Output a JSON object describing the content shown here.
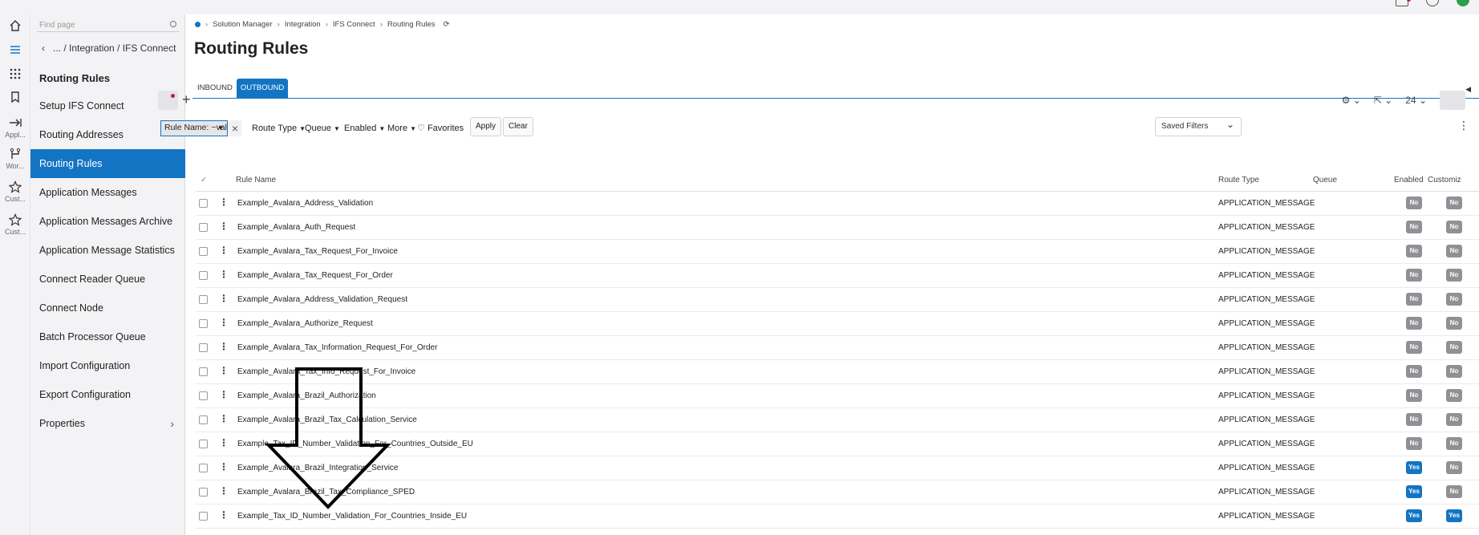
{
  "sidebar": {
    "find_placeholder": "Find page",
    "back_path": "... / Integration / IFS Connect",
    "title": "Routing Rules",
    "items": [
      {
        "label": "Setup IFS Connect",
        "has_children": true
      },
      {
        "label": "Routing Addresses"
      },
      {
        "label": "Routing Rules",
        "active": true
      },
      {
        "label": "Application Messages"
      },
      {
        "label": "Application Messages Archive"
      },
      {
        "label": "Application Message Statistics"
      },
      {
        "label": "Connect Reader Queue"
      },
      {
        "label": "Connect Node"
      },
      {
        "label": "Batch Processor Queue"
      },
      {
        "label": "Import Configuration"
      },
      {
        "label": "Export Configuration"
      },
      {
        "label": "Properties",
        "has_children": true
      }
    ]
  },
  "rail": {
    "items": [
      {
        "icon": "home-icon"
      },
      {
        "icon": "menu-icon"
      },
      {
        "icon": "apps-grid-icon"
      },
      {
        "icon": "bookmark-icon"
      },
      {
        "icon": "arrow-right-bar-icon",
        "caption": "Appl..."
      },
      {
        "icon": "workflow-icon",
        "caption": "Wor..."
      },
      {
        "icon": "star-icon",
        "caption": "Cust..."
      },
      {
        "icon": "star-icon",
        "caption": "Cust..."
      }
    ]
  },
  "breadcrumb": [
    "Solution Manager",
    "Integration",
    "IFS Connect",
    "Routing Rules"
  ],
  "page_title": "Routing Rules",
  "tabs": [
    {
      "label": "INBOUND"
    },
    {
      "label": "OUTBOUND",
      "active": true
    }
  ],
  "toolbar": {
    "page_size": "24"
  },
  "filters": {
    "chip": "Rule Name: ~val",
    "route_type": "Route Type",
    "queue": "Queue",
    "enabled": "Enabled",
    "more": "More",
    "favorites": "Favorites",
    "apply": "Apply",
    "clear": "Clear",
    "saved_filters": "Saved Filters"
  },
  "table": {
    "columns": {
      "rule_name": "Rule Name",
      "route_type": "Route Type",
      "queue": "Queue",
      "enabled": "Enabled",
      "customized": "Customiz"
    },
    "rows": [
      {
        "name": "Example_Avalara_Address_Validation",
        "route_type": "APPLICATION_MESSAGE",
        "enabled": "No",
        "customized": "No"
      },
      {
        "name": "Example_Avalara_Auth_Request",
        "route_type": "APPLICATION_MESSAGE",
        "enabled": "No",
        "customized": "No"
      },
      {
        "name": "Example_Avalara_Tax_Request_For_Invoice",
        "route_type": "APPLICATION_MESSAGE",
        "enabled": "No",
        "customized": "No"
      },
      {
        "name": "Example_Avalara_Tax_Request_For_Order",
        "route_type": "APPLICATION_MESSAGE",
        "enabled": "No",
        "customized": "No"
      },
      {
        "name": "Example_Avalara_Address_Validation_Request",
        "route_type": "APPLICATION_MESSAGE",
        "enabled": "No",
        "customized": "No"
      },
      {
        "name": "Example_Avalara_Authorize_Request",
        "route_type": "APPLICATION_MESSAGE",
        "enabled": "No",
        "customized": "No"
      },
      {
        "name": "Example_Avalara_Tax_Information_Request_For_Order",
        "route_type": "APPLICATION_MESSAGE",
        "enabled": "No",
        "customized": "No"
      },
      {
        "name": "Example_Avalara_Tax_Info_Request_For_Invoice",
        "route_type": "APPLICATION_MESSAGE",
        "enabled": "No",
        "customized": "No"
      },
      {
        "name": "Example_Avalara_Brazil_Authorization",
        "route_type": "APPLICATION_MESSAGE",
        "enabled": "No",
        "customized": "No"
      },
      {
        "name": "Example_Avalara_Brazil_Tax_Calculation_Service",
        "route_type": "APPLICATION_MESSAGE",
        "enabled": "No",
        "customized": "No"
      },
      {
        "name": "Example_Tax_ID_Number_Validation_For_Countries_Outside_EU",
        "route_type": "APPLICATION_MESSAGE",
        "enabled": "No",
        "customized": "No"
      },
      {
        "name": "Example_Avalara_Brazil_Integration_Service",
        "route_type": "APPLICATION_MESSAGE",
        "enabled": "Yes",
        "customized": "No"
      },
      {
        "name": "Example_Avalara_Brazil_Tax_Compliance_SPED",
        "route_type": "APPLICATION_MESSAGE",
        "enabled": "Yes",
        "customized": "No"
      },
      {
        "name": "Example_Tax_ID_Number_Validation_For_Countries_Inside_EU",
        "route_type": "APPLICATION_MESSAGE",
        "enabled": "Yes",
        "customized": "Yes"
      }
    ]
  },
  "colors": {
    "accent": "#1474c4",
    "badge_no": "#909095",
    "notification": "#c2185b"
  }
}
